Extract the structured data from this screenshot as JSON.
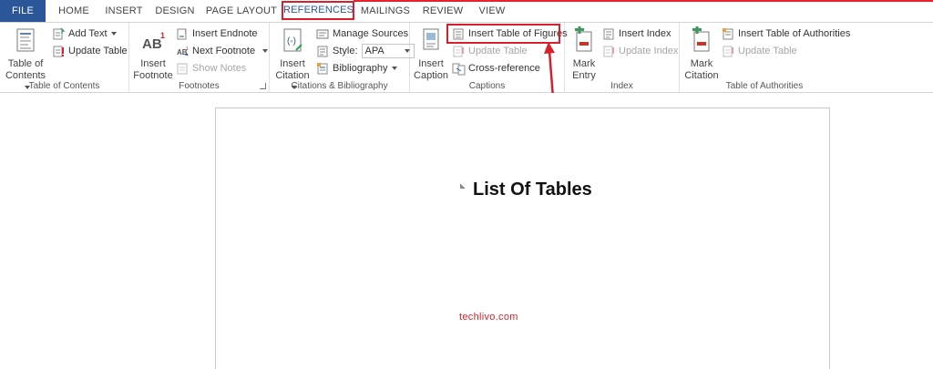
{
  "tabs": [
    {
      "label": "FILE"
    },
    {
      "label": "HOME"
    },
    {
      "label": "INSERT"
    },
    {
      "label": "DESIGN"
    },
    {
      "label": "PAGE LAYOUT"
    },
    {
      "label": "REFERENCES"
    },
    {
      "label": "MAILINGS"
    },
    {
      "label": "REVIEW"
    },
    {
      "label": "VIEW"
    }
  ],
  "groups": {
    "toc": {
      "label": "Table of Contents",
      "big_line1": "Table of",
      "big_line2": "Contents",
      "add_text": "Add Text",
      "update_table": "Update Table"
    },
    "footnotes": {
      "label": "Footnotes",
      "big_line1": "Insert",
      "big_line2": "Footnote",
      "insert_endnote": "Insert Endnote",
      "next_footnote": "Next Footnote",
      "show_notes": "Show Notes"
    },
    "citations": {
      "label": "Citations & Bibliography",
      "big_line1": "Insert",
      "big_line2": "Citation",
      "manage_sources": "Manage Sources",
      "style_label": "Style:",
      "style_value": "APA",
      "bibliography": "Bibliography"
    },
    "captions": {
      "label": "Captions",
      "big_line1": "Insert",
      "big_line2": "Caption",
      "insert_tof": "Insert Table of Figures",
      "update_table": "Update Table",
      "cross_reference": "Cross-reference"
    },
    "index": {
      "label": "Index",
      "big_line1": "Mark",
      "big_line2": "Entry",
      "insert_index": "Insert Index",
      "update_index": "Update Index"
    },
    "authorities": {
      "label": "Table of Authorities",
      "big_line1": "Mark",
      "big_line2": "Citation",
      "insert_toa": "Insert Table of Authorities",
      "update_table": "Update Table"
    }
  },
  "document": {
    "heading": "List Of Tables",
    "watermark": "techlivo.com"
  },
  "colors": {
    "file_tab": "#2b579a",
    "highlight": "#d9202a",
    "accent_green": "#3c9a5f",
    "accent_red": "#c0392b"
  }
}
